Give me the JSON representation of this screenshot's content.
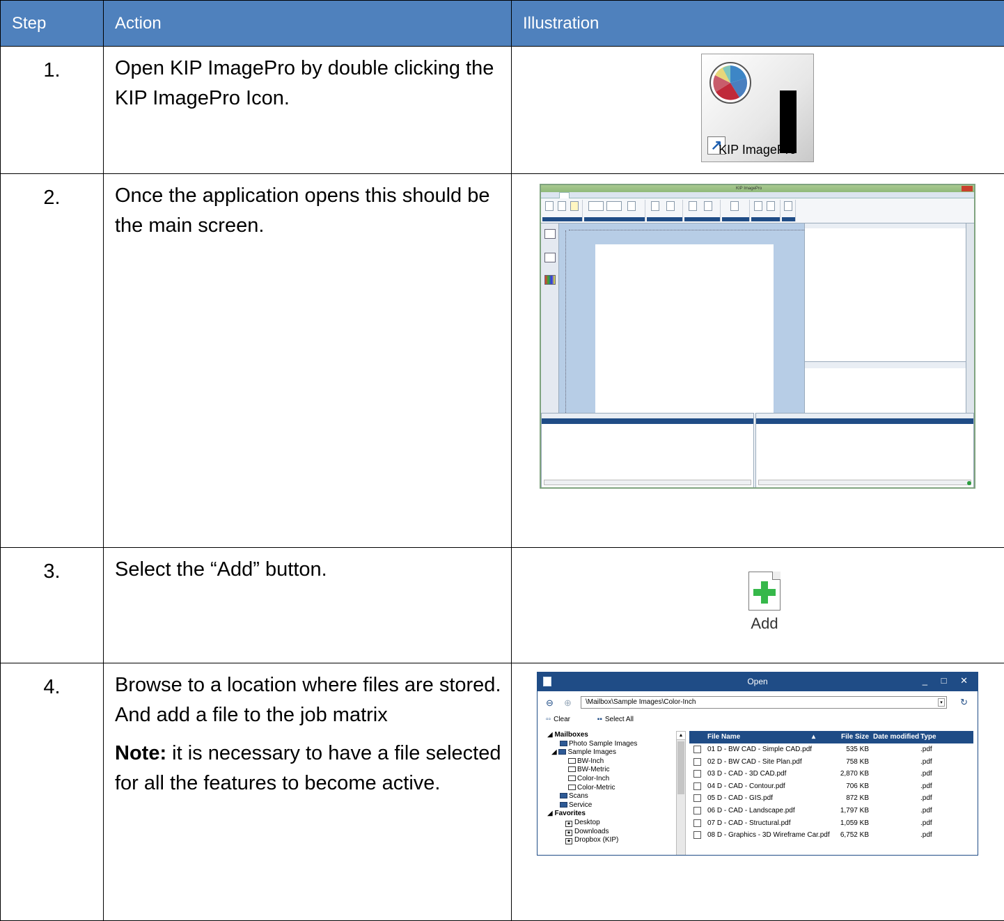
{
  "table": {
    "headers": {
      "step": "Step",
      "action": "Action",
      "illustration": "Illustration"
    },
    "rows": [
      {
        "step": "1.",
        "action": "Open KIP ImagePro by double clicking the KIP ImagePro Icon."
      },
      {
        "step": "2.",
        "action": "Once the application opens this should be the main screen."
      },
      {
        "step": "3.",
        "action": "Select the “Add” button."
      },
      {
        "step": "4.",
        "action": "Browse to a location where files are stored. And add a file to the job matrix",
        "note_label": "Note:",
        "note_text": " it is necessary to have a file selected for all the features to become active."
      }
    ]
  },
  "icon": {
    "label": "KIP ImagePro"
  },
  "app_screen": {
    "title": "KIP ImagePro"
  },
  "add_button": {
    "label": "Add"
  },
  "open_dialog": {
    "title": "Open",
    "path": "\\Mailbox\\Sample Images\\Color-Inch",
    "clear": "Clear",
    "select_all": "Select All",
    "tree": [
      "Mailboxes",
      "Photo Sample Images",
      "Sample Images",
      "BW-Inch",
      "BW-Metric",
      "Color-Inch",
      "Color-Metric",
      "Scans",
      "Service",
      "Favorites",
      "Desktop",
      "Downloads",
      "Dropbox (KIP)"
    ],
    "columns": {
      "name": "File Name",
      "size": "File Size",
      "date": "Date modified",
      "type": "Type"
    },
    "files": [
      {
        "name": "01 D - BW CAD - Simple CAD.pdf",
        "size": "535 KB",
        "type": ".pdf"
      },
      {
        "name": "02 D - BW CAD - Site Plan.pdf",
        "size": "758 KB",
        "type": ".pdf"
      },
      {
        "name": "03 D - CAD - 3D CAD.pdf",
        "size": "2,870 KB",
        "type": ".pdf"
      },
      {
        "name": "04 D - CAD - Contour.pdf",
        "size": "706 KB",
        "type": ".pdf"
      },
      {
        "name": "05 D - CAD - GIS.pdf",
        "size": "872 KB",
        "type": ".pdf"
      },
      {
        "name": "06 D - CAD - Landscape.pdf",
        "size": "1,797 KB",
        "type": ".pdf"
      },
      {
        "name": "07 D - CAD - Structural.pdf",
        "size": "1,059 KB",
        "type": ".pdf"
      },
      {
        "name": "08 D - Graphics - 3D Wireframe Car.pdf",
        "size": "6,752 KB",
        "type": ".pdf"
      }
    ]
  },
  "colors": {
    "header_bg": "#4f81bd",
    "dialog_blue": "#1f4c86",
    "add_green": "#36b84a"
  }
}
